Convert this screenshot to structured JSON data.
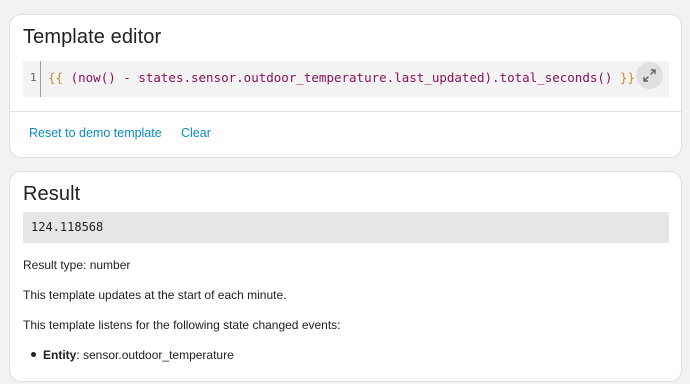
{
  "editor_card": {
    "title": "Template editor",
    "line_number": "1",
    "code": {
      "open_brace": "{{",
      "expression": " (now() - states.sensor.outdoor_temperature.last_updated).total_seconds() ",
      "close_brace": "}}"
    },
    "expand_icon": "expand-arrows-icon",
    "buttons": {
      "reset_label": "Reset to demo template",
      "clear_label": "Clear"
    }
  },
  "result_card": {
    "title": "Result",
    "value": "124.118568",
    "result_type": "Result type: number",
    "updates_text": "This template updates at the start of each minute.",
    "listens_text": "This template listens for the following state changed events:",
    "entities": [
      {
        "label": "Entity",
        "value": ": sensor.outdoor_temperature"
      }
    ]
  },
  "colors": {
    "background": "#f2f2f2",
    "card": "#ffffff",
    "accent": "#0b8bbd",
    "code_brace": "#c98a2b",
    "code_text": "#8a1256"
  }
}
